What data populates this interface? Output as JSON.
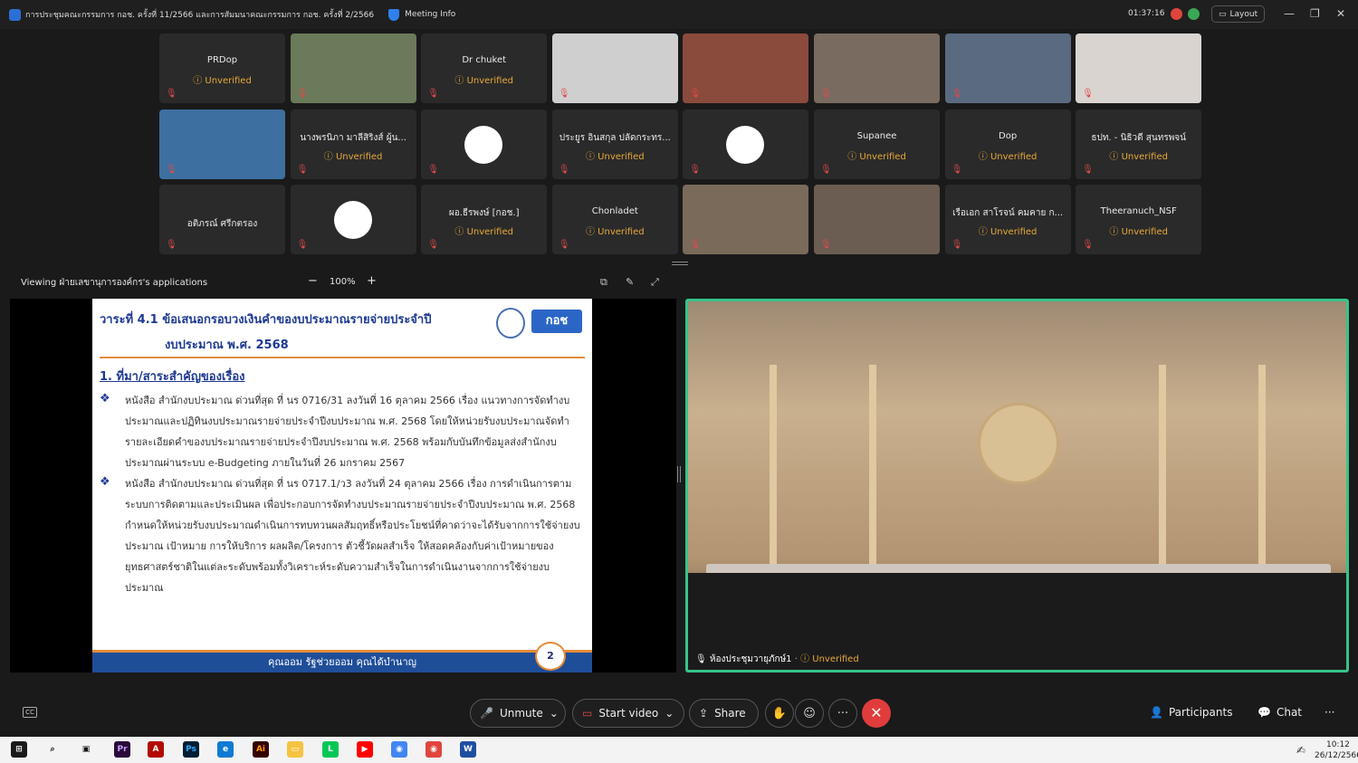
{
  "window": {
    "meeting_title": "การประชุมคณะกรรมการ กอช. ครั้งที่ 11/2566 และการสัมมนาคณะกรรมการ กอช. ครั้งที่ 2/2566",
    "meeting_info": "Meeting Info",
    "timer": "01:37:16",
    "layout_label": "Layout",
    "minimize": "—",
    "maximize": "❐",
    "close": "✕"
  },
  "participants": [
    {
      "name": "PRDop",
      "status": "Unverified",
      "video": false
    },
    {
      "name": "",
      "status": "",
      "video": true,
      "bg": "#6b7a5a"
    },
    {
      "name": "Dr chuket",
      "status": "Unverified",
      "video": false
    },
    {
      "name": "",
      "status": "",
      "video": true,
      "bg": "#cfcfcf"
    },
    {
      "name": "",
      "status": "",
      "video": true,
      "bg": "#8a4a3c"
    },
    {
      "name": "",
      "status": "",
      "video": true,
      "bg": "#7a6b60"
    },
    {
      "name": "",
      "status": "",
      "video": true,
      "bg": "#5a6a80"
    },
    {
      "name": "",
      "status": "",
      "video": true,
      "bg": "#d9d4d0"
    },
    {
      "name": "",
      "status": "",
      "video": true,
      "bg": "#3d6fa0"
    },
    {
      "name": "นางพรนิภา มาลีสิริงส์ ผู้น...",
      "status": "Unverified",
      "video": false
    },
    {
      "name": "",
      "status": "",
      "video": false,
      "avatar": true
    },
    {
      "name": "ประยูร อินสกุล ปลัดกระทร...",
      "status": "Unverified",
      "video": false
    },
    {
      "name": "",
      "status": "",
      "video": false,
      "avatar": true
    },
    {
      "name": "Supanee",
      "status": "Unverified",
      "video": false
    },
    {
      "name": "Dop",
      "status": "Unverified",
      "video": false
    },
    {
      "name": "ธปท. - นิธิวดี สุนทรพจน์",
      "status": "Unverified",
      "video": false
    },
    {
      "name": "อติภรณ์ ศรีกตรอง",
      "status": "",
      "video": false
    },
    {
      "name": "",
      "status": "",
      "video": false,
      "avatar": true
    },
    {
      "name": "ผอ.ธีรพงษ์ [กอช.]",
      "status": "Unverified",
      "video": false
    },
    {
      "name": "Chonladet",
      "status": "Unverified",
      "video": false
    },
    {
      "name": "",
      "status": "",
      "video": true,
      "bg": "#7a6a5a"
    },
    {
      "name": "",
      "status": "",
      "video": true,
      "bg": "#6b5d52"
    },
    {
      "name": "เรือเอก สาโรจน์ คมคาย ก...",
      "status": "Unverified",
      "video": false
    },
    {
      "name": "Theeranuch_NSF",
      "status": "Unverified",
      "video": false
    }
  ],
  "viewing": {
    "label": "Viewing ฝ่ายเลขานุการองค์กร's applications",
    "zoom": "100%"
  },
  "slide": {
    "agenda": "วาระที่ 4.1  ข้อเสนอกรอบวงเงินคำของบประมาณรายจ่ายประจำปี",
    "agenda_line2": "งบประมาณ พ.ศ. 2568",
    "logo": "กอช",
    "heading": "1. ที่มา/สาระสำคัญของเรื่อง",
    "bullet": "❖",
    "para1": "หนังสือ สำนักงบประมาณ ด่วนที่สุด ที่ นร 0716/31 ลงวันที่ 16 ตุลาคม 2566 เรื่อง แนวทางการจัดทำงบประมาณและปฏิทินงบประมาณรายจ่ายประจำปีงบประมาณ พ.ศ. 2568 โดยให้หน่วยรับงบประมาณจัดทำรายละเอียดคำของบประมาณรายจ่ายประจำปีงบประมาณ พ.ศ. 2568 พร้อมกับบันทึกข้อมูลส่งสำนักงบประมาณผ่านระบบ  e-Budgeting ภายในวันที่ 26 มกราคม 2567",
    "para2": "หนังสือ สำนักงบประมาณ ด่วนที่สุด ที่ นร 0717.1/ว3 ลงวันที่ 24 ตุลาคม 2566 เรื่อง การดำเนินการตามระบบการติดตามและประเมินผล เพื่อประกอบการจัดทำงบประมาณรายจ่ายประจำปีงบประมาณ พ.ศ. 2568 กำหนดให้หน่วยรับงบประมาณดำเนินการทบทวนผลสัมฤทธิ์หรือประโยชน์ที่คาดว่าจะได้รับจากการใช้จ่ายงบประมาณ เป้าหมาย การให้บริการ ผลผลิต/โครงการ ตัวชี้วัดผลสำเร็จ ให้สอดคล้องกับค่าเป้าหมายของยุทธศาสตร์ชาติในแต่ละระดับพร้อมทั้งวิเคราะห์ระดับความสำเร็จในการดำเนินงานจากการใช้จ่ายงบประมาณ",
    "footer": "คุณออม รัฐช่วยออม คุณได้บำนาญ",
    "page": "2"
  },
  "speaker": {
    "room_name": "ห้องประชุมวายุภักษ์1",
    "status": "Unverified"
  },
  "controls": {
    "cc": "CC",
    "unmute": "Unmute",
    "start_video": "Start video",
    "share": "Share",
    "participants": "Participants",
    "chat": "Chat",
    "more": "···"
  },
  "taskbar": {
    "time": "10:12",
    "date": "26/12/2566"
  }
}
